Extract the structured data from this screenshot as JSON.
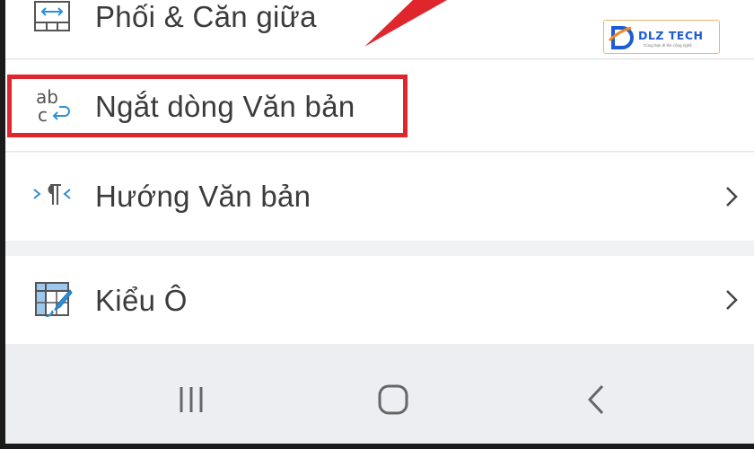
{
  "menu": {
    "merge_center": {
      "label": "Phối & Căn giữa",
      "icon": "merge-cells-icon"
    },
    "wrap_text": {
      "label": "Ngắt dòng Văn bản",
      "icon": "wrap-text-icon",
      "icon_text_top": "ab",
      "icon_text_bottom": "c"
    },
    "text_direction": {
      "label": "Hướng Văn bản",
      "icon": "text-direction-icon"
    },
    "cell_style": {
      "label": "Kiểu Ô",
      "icon": "cell-style-icon"
    }
  },
  "annotation": {
    "highlight_color": "#e0262d"
  },
  "watermark": {
    "brand": "DLZ TECH",
    "tagline": "Cùng bạn đi lên công nghệ",
    "brand_color": "#1e5bd6"
  },
  "navbar": {
    "recent_icon": "recent-apps-icon",
    "home_icon": "home-icon",
    "back_icon": "back-icon"
  }
}
